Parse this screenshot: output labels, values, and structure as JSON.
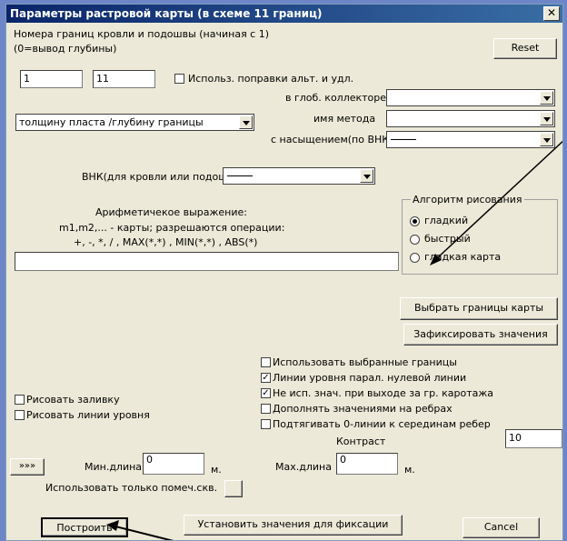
{
  "window": {
    "title": "Параметры растровой карты (в схеме 11 границ)",
    "close": "✕"
  },
  "left": {
    "heading_line1": "Номера границ кровли и подошвы  (начиная с 1)",
    "heading_line2": "(0=вывод глубины)",
    "from_value": "1",
    "to_value": "11",
    "mode_select": "толщину пласта /глубину границы",
    "vnk_label": "ВНК(для кровли или подошвы):",
    "expr_line1": "Арифметичекое выражение:",
    "expr_line2": "m1,m2,... - карты; разрешаются операции:",
    "expr_line3": "+, -, *, / , MAX(*,*) , MIN(*,*) , ABS(*)",
    "expr_value": "",
    "draw_fill": "Рисовать заливку",
    "draw_lines": "Рисовать линии уровня",
    "more_button": "»»»",
    "min_len_label": "Мин.длина",
    "min_len_value": "0",
    "min_len_unit": "м.",
    "max_len_label": "Мах.длина",
    "max_len_value": "0",
    "max_len_unit": "м.",
    "marked_wells": "Использовать только помеч.скв."
  },
  "right": {
    "reset": "Reset",
    "use_corrections": "Использ. поправки альт. и удл.",
    "collector_label": "в глоб. коллекторе",
    "method_label": "имя метода",
    "saturation_label": "с насыщением(по ВНК)"
  },
  "algo": {
    "title": "Алгоритм рисования",
    "options": [
      "гладкий",
      "быстрый",
      "гладкая карта"
    ],
    "selected": 0
  },
  "buttons": {
    "select_bounds": "Выбрать границы карты",
    "fix_values": "Зафиксировать значения",
    "build": "Построить",
    "set_values": "Установить значения для фиксации",
    "cancel": "Cancel"
  },
  "options": {
    "items": [
      {
        "label": "Использовать выбранные границы",
        "checked": false
      },
      {
        "label": "Линии уровня парал. нулевой линии",
        "checked": true
      },
      {
        "label": "Не исп. знач. при выходе за гр. каротажа",
        "checked": true
      },
      {
        "label": "Дополнять значениями на ребрах",
        "checked": false
      },
      {
        "label": "Подтягивать 0-линии к серединам ребер",
        "checked": false
      }
    ],
    "contrast_label": "Контраст",
    "contrast_value": "10"
  },
  "colors": {
    "titlebar": "#0a246a",
    "dialog": "#ece9d8",
    "backdrop": "#6e86c8"
  }
}
